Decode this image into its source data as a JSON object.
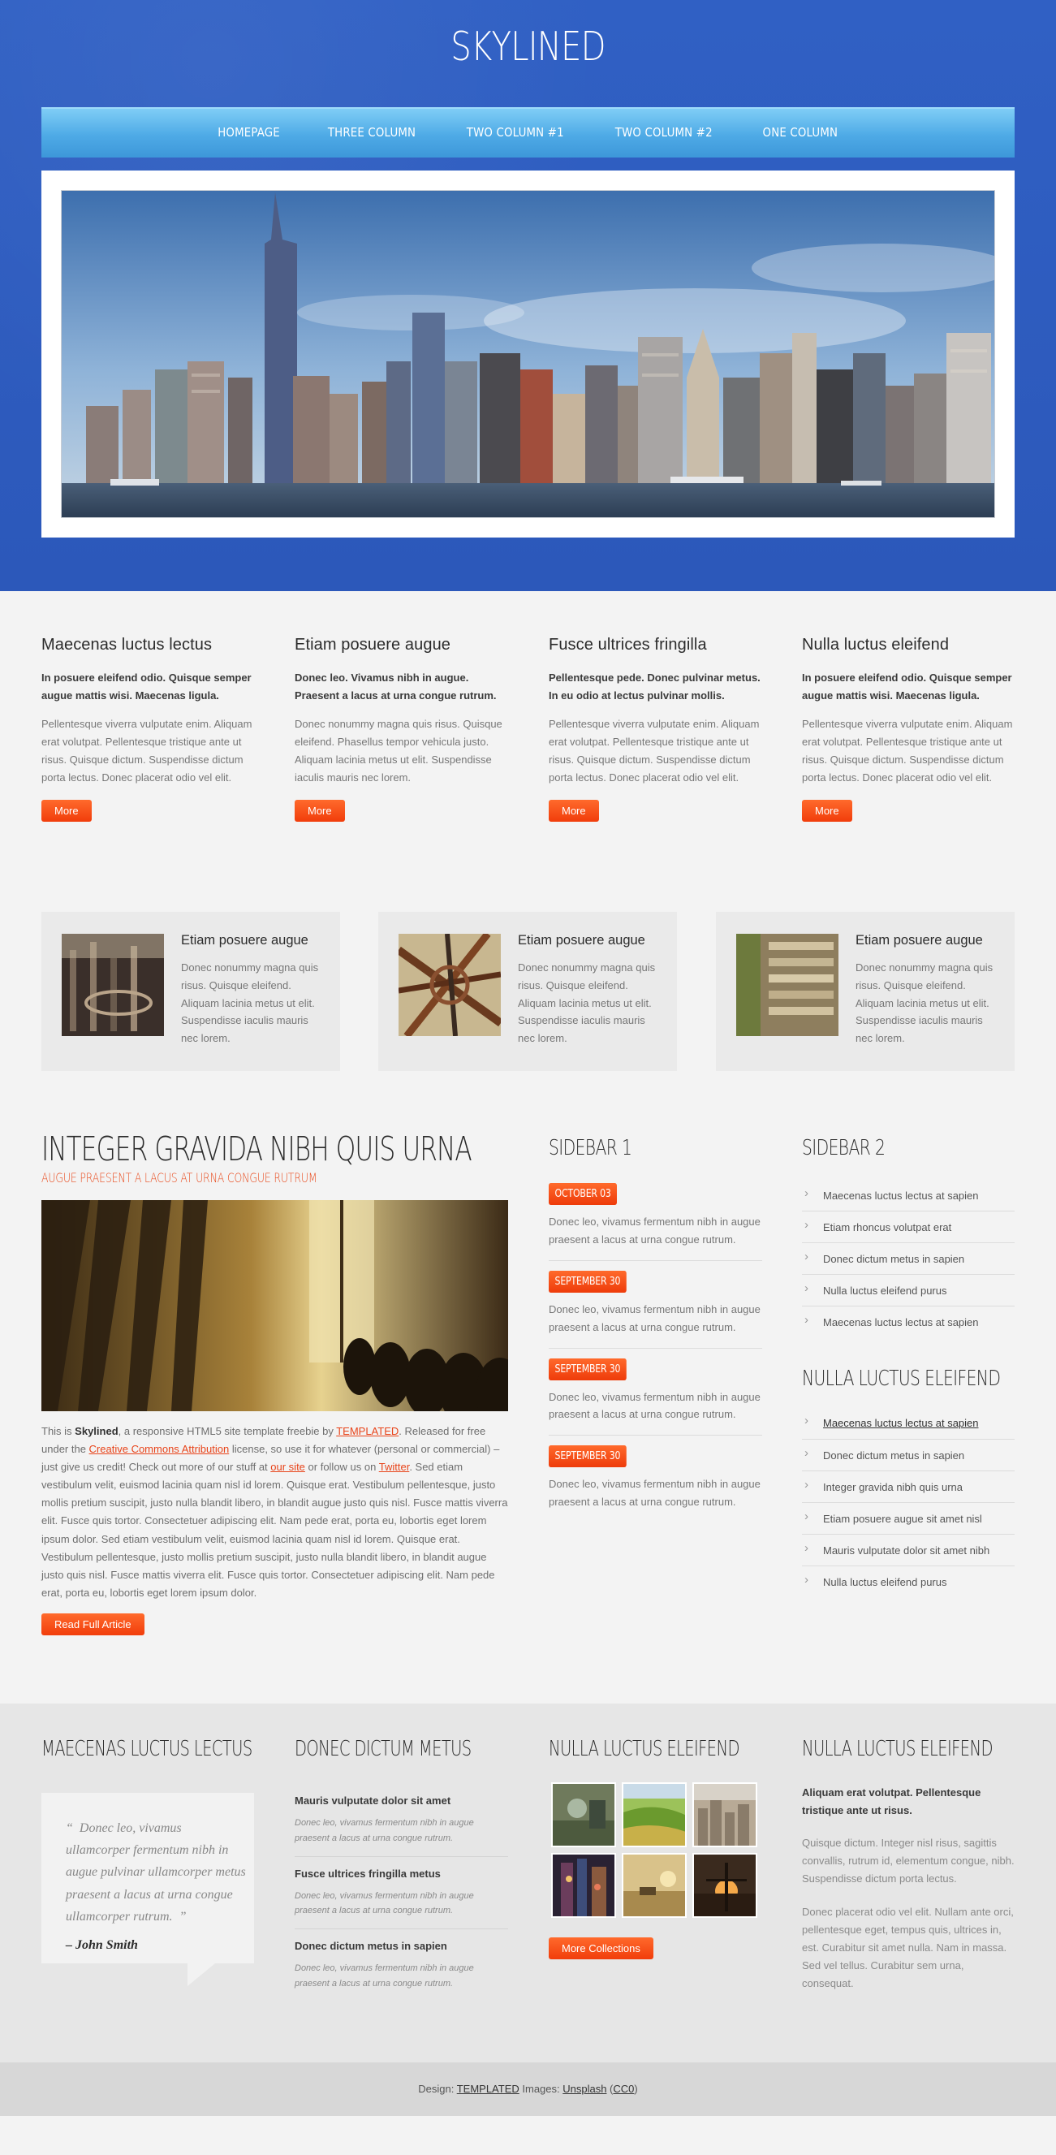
{
  "site": {
    "logo": "SKYLINED"
  },
  "nav": [
    "HOMEPAGE",
    "THREE COLUMN",
    "TWO COLUMN #1",
    "TWO COLUMN #2",
    "ONE COLUMN"
  ],
  "colors": {
    "header_bg": "#2f5bbd",
    "nav_bg": "#4eaae6",
    "accent": "#f13d0b",
    "page_bg": "#f3f3f3"
  },
  "features": [
    {
      "title": "Maecenas luctus lectus",
      "lead": "In posuere eleifend odio. Quisque semper augue mattis wisi. Maecenas ligula.",
      "body": "Pellentesque viverra vulputate enim. Aliquam erat volutpat. Pellentesque tristique ante ut risus. Quisque dictum. Suspendisse dictum porta lectus. Donec placerat odio vel elit.",
      "button": "More"
    },
    {
      "title": "Etiam posuere augue",
      "lead": "Donec leo. Vivamus nibh in augue. Praesent a lacus at urna congue rutrum.",
      "body": "Donec nonummy magna quis risus. Quisque eleifend. Phasellus tempor vehicula justo. Aliquam lacinia metus ut elit. Suspendisse iaculis mauris nec lorem.",
      "button": "More"
    },
    {
      "title": "Fusce ultrices fringilla",
      "lead": "Pellentesque pede. Donec pulvinar metus. In eu odio at lectus pulvinar mollis.",
      "body": "Pellentesque viverra vulputate enim. Aliquam erat volutpat. Pellentesque tristique ante ut risus. Quisque dictum. Suspendisse dictum porta lectus. Donec placerat odio vel elit.",
      "button": "More"
    },
    {
      "title": "Nulla luctus eleifend",
      "lead": "In posuere eleifend odio. Quisque semper augue mattis wisi. Maecenas ligula.",
      "body": "Pellentesque viverra vulputate enim. Aliquam erat volutpat. Pellentesque tristique ante ut risus. Quisque dictum. Suspendisse dictum porta lectus. Donec placerat odio vel elit.",
      "button": "More"
    }
  ],
  "boxes": [
    {
      "title": "Etiam posuere augue",
      "body": "Donec nonummy magna quis risus. Quisque eleifend. Aliquam lacinia metus ut elit. Suspendisse iaculis mauris nec lorem."
    },
    {
      "title": "Etiam posuere augue",
      "body": "Donec nonummy magna quis risus. Quisque eleifend. Aliquam lacinia metus ut elit. Suspendisse iaculis mauris nec lorem."
    },
    {
      "title": "Etiam posuere augue",
      "body": "Donec nonummy magna quis risus. Quisque eleifend. Aliquam lacinia metus ut elit. Suspendisse iaculis mauris nec lorem."
    }
  ],
  "article": {
    "title": "INTEGER GRAVIDA NIBH QUIS URNA",
    "subtitle": "AUGUE PRAESENT A LACUS AT URNA CONGUE RUTRUM",
    "text_1": "This is ",
    "brand": "Skylined",
    "text_2": ", a responsive HTML5 site template freebie by ",
    "link_templated": "TEMPLATED",
    "text_3": ". Released for free under the ",
    "link_license": "Creative Commons Attribution",
    "text_4": " license, so use it for whatever (personal or commercial) – just give us credit! Check out more of our stuff at ",
    "link_site": "our site",
    "text_5": " or follow us on ",
    "link_twitter": "Twitter",
    "text_6": ". Sed etiam vestibulum velit, euismod lacinia quam nisl id lorem. Quisque erat. Vestibulum pellentesque, justo mollis pretium suscipit, justo nulla blandit libero, in blandit augue justo quis nisl. Fusce mattis viverra elit. Fusce quis tortor. Consectetuer adipiscing elit. Nam pede erat, porta eu, lobortis eget lorem ipsum dolor. Sed etiam vestibulum velit, euismod lacinia quam nisl id lorem. Quisque erat. Vestibulum pellentesque, justo mollis pretium suscipit, justo nulla blandit libero, in blandit augue justo quis nisl. Fusce mattis viverra elit. Fusce quis tortor. Consectetuer adipiscing elit. Nam pede erat, porta eu, lobortis eget lorem ipsum dolor.",
    "button": "Read Full Article"
  },
  "sidebar1": {
    "title": "SIDEBAR 1",
    "items": [
      {
        "date": "OCTOBER 03",
        "text": "Donec leo, vivamus fermentum nibh in augue praesent a lacus at urna congue rutrum."
      },
      {
        "date": "SEPTEMBER 30",
        "text": "Donec leo, vivamus fermentum nibh in augue praesent a lacus at urna congue rutrum."
      },
      {
        "date": "SEPTEMBER 30",
        "text": "Donec leo, vivamus fermentum nibh in augue praesent a lacus at urna congue rutrum."
      },
      {
        "date": "SEPTEMBER 30",
        "text": "Donec leo, vivamus fermentum nibh in augue praesent a lacus at urna congue rutrum."
      }
    ]
  },
  "sidebar2": {
    "title": "SIDEBAR 2",
    "items": [
      "Maecenas luctus lectus at sapien",
      "Etiam rhoncus volutpat erat",
      "Donec dictum metus in sapien",
      "Nulla luctus eleifend purus",
      "Maecenas luctus lectus at sapien"
    ],
    "title_2": "NULLA LUCTUS ELEIFEND",
    "items_2": [
      "Maecenas luctus lectus at sapien",
      "Donec dictum metus in sapien",
      "Integer gravida nibh quis urna",
      "Etiam posuere augue sit amet nisl",
      "Mauris vulputate dolor sit amet nibh",
      "Nulla luctus eleifend purus"
    ]
  },
  "footer": {
    "col1_title": "MAECENAS LUCTUS LECTUS",
    "quote_open": "“",
    "quote": "Donec leo, vivamus ullamcorper fermentum nibh in augue pulvinar ullamcorper metus praesent a lacus at urna congue ullamcorper rutrum.",
    "quote_close": "”",
    "quote_author": "– John Smith",
    "col2_title": "DONEC DICTUM METUS",
    "col2_items": [
      {
        "title": "Mauris vulputate dolor sit amet",
        "text": "Donec leo, vivamus fermentum nibh in augue praesent a lacus at urna congue rutrum."
      },
      {
        "title": "Fusce ultrices fringilla metus",
        "text": "Donec leo, vivamus fermentum nibh in augue praesent a lacus at urna congue rutrum."
      },
      {
        "title": "Donec dictum metus in sapien",
        "text": "Donec leo, vivamus fermentum nibh in augue praesent a lacus at urna congue rutrum."
      }
    ],
    "col3_title": "NULLA LUCTUS ELEIFEND",
    "col3_button": "More Collections",
    "col4_title": "NULLA LUCTUS ELEIFEND",
    "col4_lead": "Aliquam erat volutpat. Pellentesque tristique ante ut risus.",
    "col4_p1": "Quisque dictum. Integer nisl risus, sagittis convallis, rutrum id, elementum congue, nibh. Suspendisse dictum porta lectus.",
    "col4_p2": "Donec placerat odio vel elit. Nullam ante orci, pellentesque eget, tempus quis, ultrices in, est. Curabitur sit amet nulla. Nam in massa. Sed vel tellus. Curabitur sem urna, consequat."
  },
  "copyright": {
    "design_label": "Design: ",
    "design_link": "TEMPLATED",
    "images_label": " Images: ",
    "images_link": "Unsplash",
    "cc_open": " (",
    "cc_link": "CC0",
    "cc_close": ")"
  }
}
